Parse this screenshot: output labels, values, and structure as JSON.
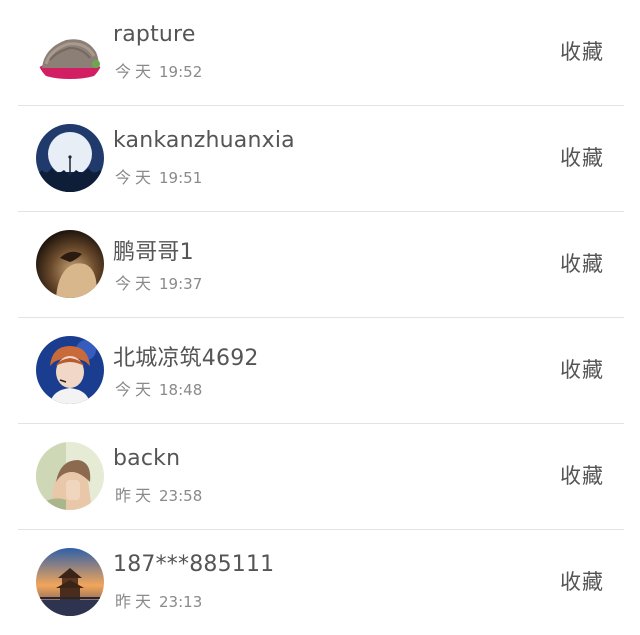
{
  "rows": [
    {
      "name": "rapture",
      "day": "今天",
      "time": "19:52",
      "action": "收藏",
      "avatar": "hat-avatar"
    },
    {
      "name": "kankanzhuanxia",
      "day": "今天",
      "time": "19:51",
      "action": "收藏",
      "avatar": "moon-avatar"
    },
    {
      "name": "鹏哥哥1",
      "day": "今天",
      "time": "19:37",
      "action": "收藏",
      "avatar": "portrait-avatar"
    },
    {
      "name": "北城凉筑4692",
      "day": "今天",
      "time": "18:48",
      "action": "收藏",
      "avatar": "singer-avatar"
    },
    {
      "name": "backn",
      "day": "昨天",
      "time": "23:58",
      "action": "收藏",
      "avatar": "girl-avatar"
    },
    {
      "name": "187***885111",
      "day": "昨天",
      "time": "23:13",
      "action": "收藏",
      "avatar": "pavilion-avatar"
    }
  ]
}
